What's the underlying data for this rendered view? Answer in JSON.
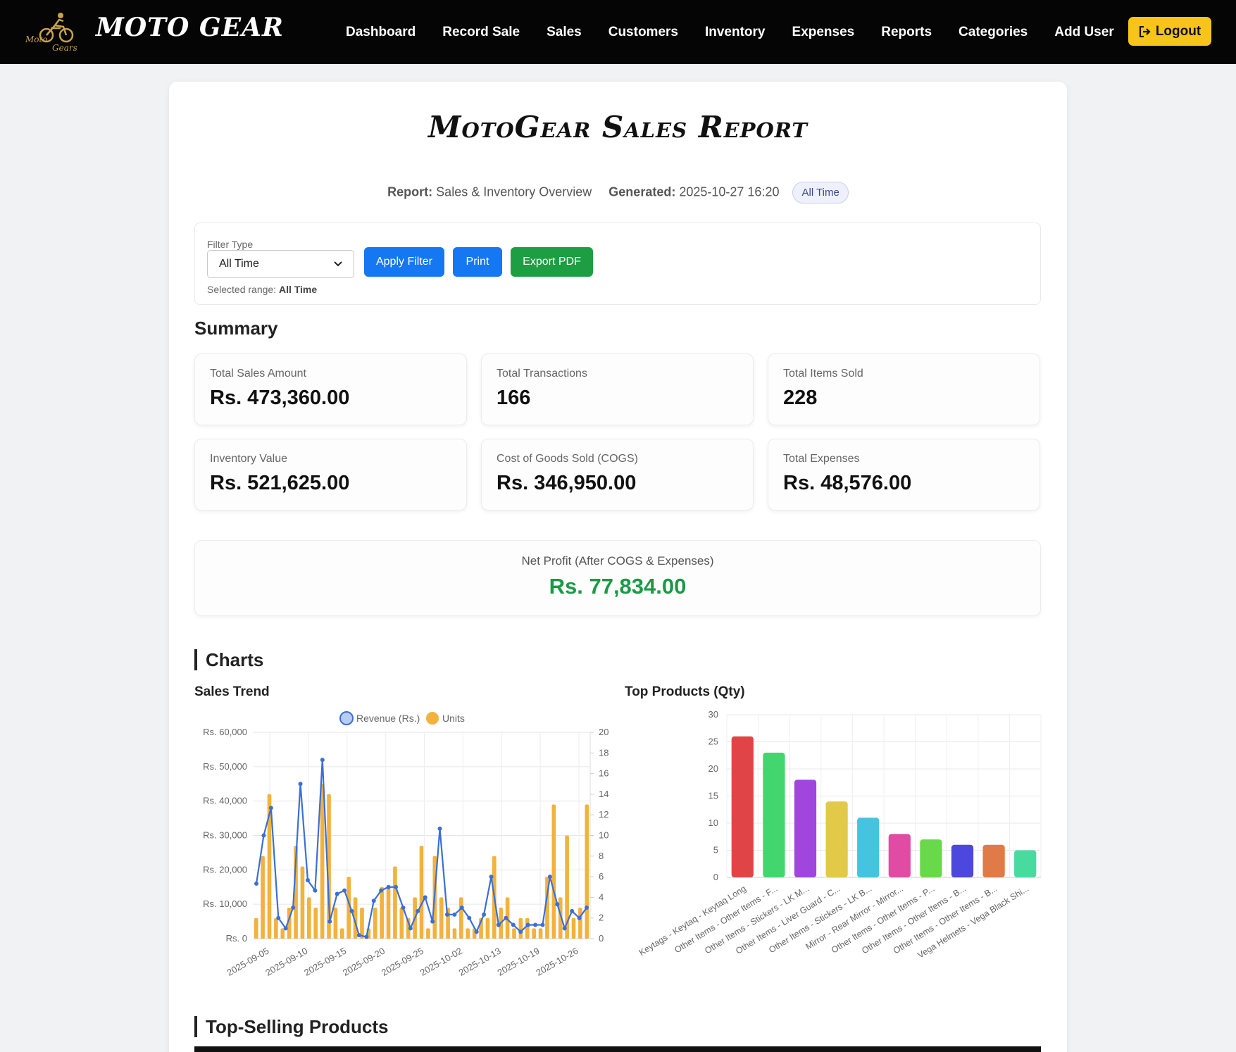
{
  "nav": {
    "brand": "MOTO GEAR",
    "logo_text": "Moto Gears",
    "links": [
      "Dashboard",
      "Record Sale",
      "Sales",
      "Customers",
      "Inventory",
      "Expenses",
      "Reports",
      "Categories",
      "Add User"
    ],
    "logout": "Logout"
  },
  "report": {
    "title": "MotoGear Sales Report",
    "report_label": "Report:",
    "report_value": "Sales & Inventory Overview",
    "generated_label": "Generated:",
    "generated_value": "2025-10-27 16:20",
    "period_badge": "All Time"
  },
  "filter": {
    "label": "Filter Type",
    "selected": "All Time",
    "range_label": "Selected range:",
    "range_value": "All Time",
    "apply": "Apply Filter",
    "print": "Print",
    "export": "Export PDF"
  },
  "summary": {
    "heading": "Summary",
    "total_sales_label": "Total Sales Amount",
    "total_sales_value": "Rs. 473,360.00",
    "total_transactions_label": "Total Transactions",
    "total_transactions_value": "166",
    "total_items_label": "Total Items Sold",
    "total_items_value": "228",
    "inventory_value_label": "Inventory Value",
    "inventory_value_value": "Rs. 521,625.00",
    "cogs_label": "Cost of Goods Sold (COGS)",
    "cogs_value": "Rs. 346,950.00",
    "expenses_label": "Total Expenses",
    "expenses_value": "Rs. 48,576.00",
    "net_profit_label": "Net Profit (After COGS & Expenses)",
    "net_profit_value": "Rs. 77,834.00"
  },
  "charts_heading": "Charts",
  "top_selling_heading": "Top-Selling Products",
  "colors": {
    "nav_bg": "#050505",
    "logout_bg": "#f7c51a",
    "primary": "#1677f2",
    "success": "#1e9e43",
    "profit": "#1a9a45",
    "revenue_line": "#3b6fd6",
    "units_bar": "#f2b23d"
  },
  "chart_data": [
    {
      "type": "bar",
      "title": "Sales Trend",
      "legend": [
        "Revenue (Rs.)",
        "Units"
      ],
      "legend_position": "top",
      "x_tick_labels": [
        "2025-09-05",
        "2025-09-10",
        "2025-09-15",
        "2025-09-20",
        "2025-09-25",
        "2025-10-02",
        "2025-10-13",
        "2025-10-19",
        "2025-10-26"
      ],
      "y_left_ticks": [
        "Rs. 0",
        "Rs. 10,000",
        "Rs. 20,000",
        "Rs. 30,000",
        "Rs. 40,000",
        "Rs. 50,000",
        "Rs. 60,000"
      ],
      "y_right_ticks": [
        "0",
        "2",
        "4",
        "6",
        "8",
        "10",
        "12",
        "14",
        "16",
        "18",
        "20"
      ],
      "y_left_range": [
        0,
        60000
      ],
      "y_right_range": [
        0,
        20
      ],
      "grid": true,
      "series": [
        {
          "name": "Units",
          "kind": "bar",
          "values": [
            2,
            8,
            14,
            2,
            1,
            3,
            9,
            7,
            4,
            3,
            15,
            14,
            3,
            1,
            6,
            4,
            3,
            1,
            3,
            5,
            5,
            7,
            3,
            2,
            4,
            9,
            1,
            8,
            4,
            3,
            1,
            4,
            1,
            1,
            2,
            2,
            8,
            3,
            4,
            1,
            2,
            2,
            1,
            1,
            6,
            13,
            4,
            10,
            2,
            3,
            13
          ]
        },
        {
          "name": "Revenue (Rs.)",
          "kind": "line",
          "values": [
            16000,
            30000,
            38000,
            6000,
            3000,
            9000,
            45000,
            17000,
            14000,
            52000,
            5000,
            13000,
            14000,
            8000,
            1000,
            500,
            11000,
            14000,
            15000,
            15000,
            9000,
            3000,
            8000,
            12000,
            5000,
            32000,
            7000,
            7000,
            9000,
            6000,
            2000,
            7000,
            18000,
            4000,
            6000,
            4000,
            2000,
            4000,
            4000,
            4000,
            18000,
            10000,
            3000,
            8000,
            6000,
            9000
          ]
        }
      ]
    },
    {
      "type": "bar",
      "title": "Top Products (Qty)",
      "categories": [
        "Keytags - Keytaq - Keytaq Long",
        "Other Items - Other Items - F...",
        "Other Items - Stickers - LK M...",
        "Other Items - Liver Guard - C...",
        "Other Items - Stickers - LK B...",
        "Mirror - Rear Mirror - Mirror...",
        "Other Items - Other Items - P...",
        "Other Items - Other Items - B...",
        "Other Items - Other Items - B...",
        "Vega Helmets - Vega Black Shi..."
      ],
      "values": [
        26,
        23,
        18,
        14,
        11,
        8,
        7,
        6,
        6,
        5
      ],
      "colors": [
        "#e04447",
        "#43d66e",
        "#a045dd",
        "#e2c947",
        "#45c3df",
        "#e04ba3",
        "#69d94b",
        "#4c47dd",
        "#e07b47",
        "#47dba0"
      ],
      "y_ticks": [
        "0",
        "5",
        "10",
        "15",
        "20",
        "25",
        "30"
      ],
      "ylim": [
        0,
        30
      ],
      "grid": true
    }
  ]
}
